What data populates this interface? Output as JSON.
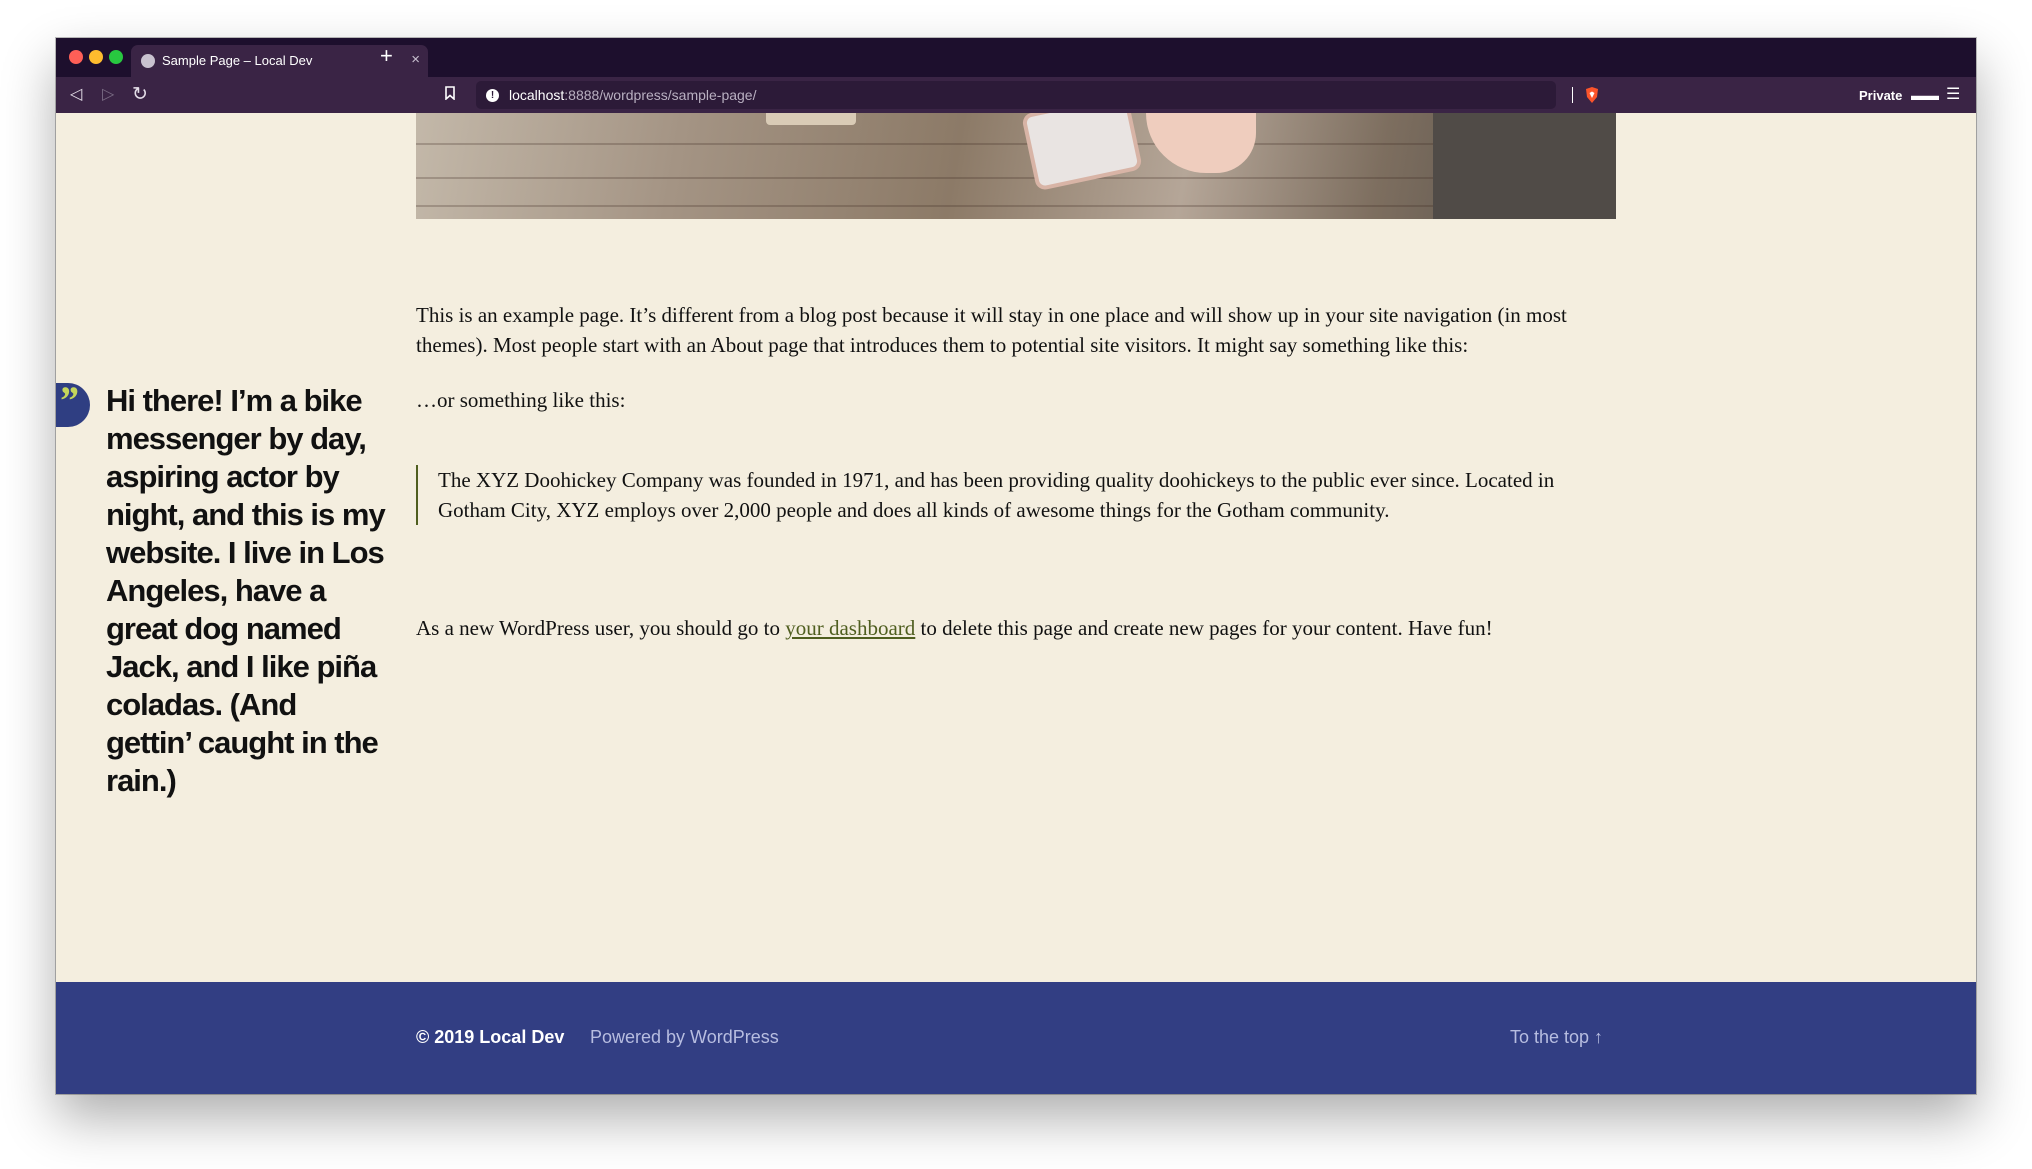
{
  "browser": {
    "tab_title": "Sample Page – Local Dev",
    "tab_close": "×",
    "new_tab": "+",
    "url_host": "localhost",
    "url_path": ":8888/wordpress/sample-page/",
    "private_label": "Private",
    "icons": {
      "back": "back-arrow-icon",
      "forward": "forward-arrow-icon",
      "reload": "reload-icon",
      "bookmark": "bookmark-icon",
      "info": "info-icon",
      "shield": "brave-shield-icon",
      "private": "private-glasses-icon",
      "menu": "hamburger-menu-icon"
    }
  },
  "page": {
    "intro": "This is an example page. It’s different from a blog post because it will stay in one place and will show up in your site navigation (in most themes). Most people start with an About page that introduces them to potential site visitors. It might say something like this:",
    "or_something": "…or something like this:",
    "pullquote": "Hi there! I’m a bike messenger by day, aspiring actor by night, and this is my website. I live in Los Angeles, have a great dog named Jack, and I like piña coladas. (And gettin’ caught in the rain.)",
    "blockquote": "The XYZ Doohickey Company was founded in 1971, and has been providing quality doohickeys to the public ever since. Located in Gotham City, XYZ employs over 2,000 people and does all kinds of awesome things for the Gotham community.",
    "dashboard_prefix": "As a new WordPress user, you should go to ",
    "dashboard_link": "your dashboard",
    "dashboard_suffix": " to delete this page and create new pages for your content. Have fun!"
  },
  "footer": {
    "copyright": "© 2019 Local Dev",
    "powered": "Powered by WordPress",
    "to_top": "To the top ↑"
  },
  "colors": {
    "page_background": "#f4eedf",
    "footer_background": "#323e83",
    "link": "#4f5e1f",
    "pullquote_accent": "#c5d65b",
    "browser_chrome": "#1d0f2d"
  }
}
